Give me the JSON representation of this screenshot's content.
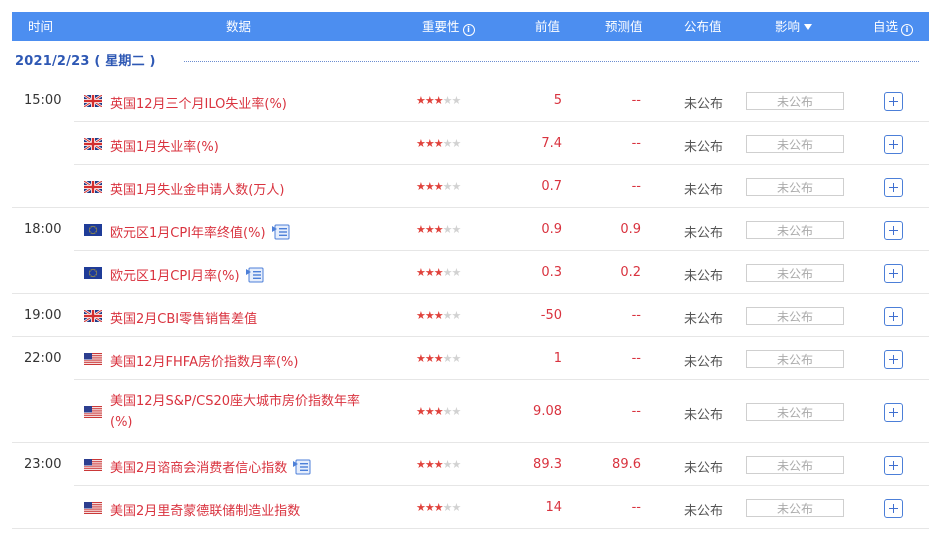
{
  "header": {
    "time": "时间",
    "data": "数据",
    "importance": "重要性",
    "previous": "前值",
    "forecast": "预测值",
    "actual": "公布值",
    "impact": "影响",
    "watchlist": "自选"
  },
  "date": "2021/2/23 ( 星期二 )",
  "colors": {
    "header_bg": "#4c8ef0",
    "accent_red": "#d9333f",
    "date_blue": "#2e58b4",
    "star_on": "#e0423c",
    "star_off": "#d2d2d2"
  },
  "rows": [
    {
      "time": "15:00",
      "country": "uk",
      "name": "英国12月三个月ILO失业率(%)",
      "stars": 3,
      "previous": "5",
      "forecast": "--",
      "actual": "未公布",
      "impact": "未公布",
      "chart_icon": false
    },
    {
      "time": "",
      "country": "uk",
      "name": "英国1月失业率(%)",
      "stars": 3,
      "previous": "7.4",
      "forecast": "--",
      "actual": "未公布",
      "impact": "未公布",
      "chart_icon": false
    },
    {
      "time": "",
      "country": "uk",
      "name": "英国1月失业金申请人数(万人)",
      "stars": 3,
      "previous": "0.7",
      "forecast": "--",
      "actual": "未公布",
      "impact": "未公布",
      "chart_icon": false
    },
    {
      "time": "18:00",
      "country": "eu",
      "name": "欧元区1月CPI年率终值(%)",
      "stars": 3,
      "previous": "0.9",
      "forecast": "0.9",
      "actual": "未公布",
      "impact": "未公布",
      "chart_icon": true
    },
    {
      "time": "",
      "country": "eu",
      "name": "欧元区1月CPI月率(%)",
      "stars": 3,
      "previous": "0.3",
      "forecast": "0.2",
      "actual": "未公布",
      "impact": "未公布",
      "chart_icon": true
    },
    {
      "time": "19:00",
      "country": "uk",
      "name": "英国2月CBI零售销售差值",
      "stars": 3,
      "previous": "-50",
      "forecast": "--",
      "actual": "未公布",
      "impact": "未公布",
      "chart_icon": false
    },
    {
      "time": "22:00",
      "country": "us",
      "name": "美国12月FHFA房价指数月率(%)",
      "stars": 3,
      "previous": "1",
      "forecast": "--",
      "actual": "未公布",
      "impact": "未公布",
      "chart_icon": false
    },
    {
      "time": "",
      "country": "us",
      "name": "美国12月S&P/CS20座大城市房价指数年率(%)",
      "stars": 3,
      "previous": "9.08",
      "forecast": "--",
      "actual": "未公布",
      "impact": "未公布",
      "chart_icon": false
    },
    {
      "time": "23:00",
      "country": "us",
      "name": "美国2月谘商会消费者信心指数",
      "stars": 3,
      "previous": "89.3",
      "forecast": "89.6",
      "actual": "未公布",
      "impact": "未公布",
      "chart_icon": true
    },
    {
      "time": "",
      "country": "us",
      "name": "美国2月里奇蒙德联储制造业指数",
      "stars": 3,
      "previous": "14",
      "forecast": "--",
      "actual": "未公布",
      "impact": "未公布",
      "chart_icon": false
    }
  ]
}
